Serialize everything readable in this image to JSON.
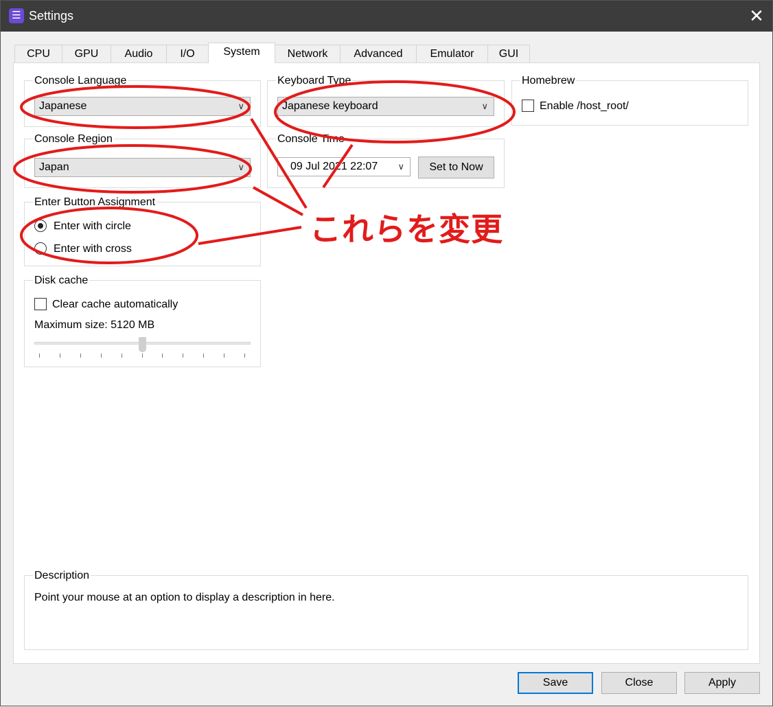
{
  "window": {
    "title": "Settings",
    "close_glyph": "✕",
    "app_icon": "rpcs3-app-icon"
  },
  "tabs": [
    {
      "label": "CPU"
    },
    {
      "label": "GPU"
    },
    {
      "label": "Audio"
    },
    {
      "label": "I/O"
    },
    {
      "label": "System",
      "active": true
    },
    {
      "label": "Network"
    },
    {
      "label": "Advanced"
    },
    {
      "label": "Emulator"
    },
    {
      "label": "GUI"
    }
  ],
  "console_language": {
    "label": "Console Language",
    "value": "Japanese"
  },
  "console_region": {
    "label": "Console Region",
    "value": "Japan"
  },
  "enter_button": {
    "label": "Enter Button Assignment",
    "options": [
      {
        "label": "Enter with circle",
        "checked": true
      },
      {
        "label": "Enter with cross",
        "checked": false
      }
    ]
  },
  "disk_cache": {
    "label": "Disk cache",
    "clear_auto_label": "Clear cache automatically",
    "clear_auto_checked": false,
    "max_size_label": "Maximum size: 5120 MB",
    "slider_fraction": 0.5
  },
  "keyboard_type": {
    "label": "Keyboard Type",
    "value": "Japanese keyboard"
  },
  "console_time": {
    "label": "Console Time",
    "value": "09 Jul 2021 22:07",
    "set_now_label": "Set to Now"
  },
  "homebrew": {
    "label": "Homebrew",
    "enable_label": "Enable /host_root/",
    "checked": false
  },
  "description": {
    "label": "Description",
    "text": "Point your mouse at an option to display a description in here."
  },
  "footer": {
    "save": "Save",
    "close": "Close",
    "apply": "Apply"
  },
  "annotation": {
    "text": "これらを変更",
    "color": "#e21b1b"
  },
  "colors": {
    "titlebar": "#3c3c3c",
    "accent": "#0078d7",
    "annotation": "#e21b1b"
  }
}
